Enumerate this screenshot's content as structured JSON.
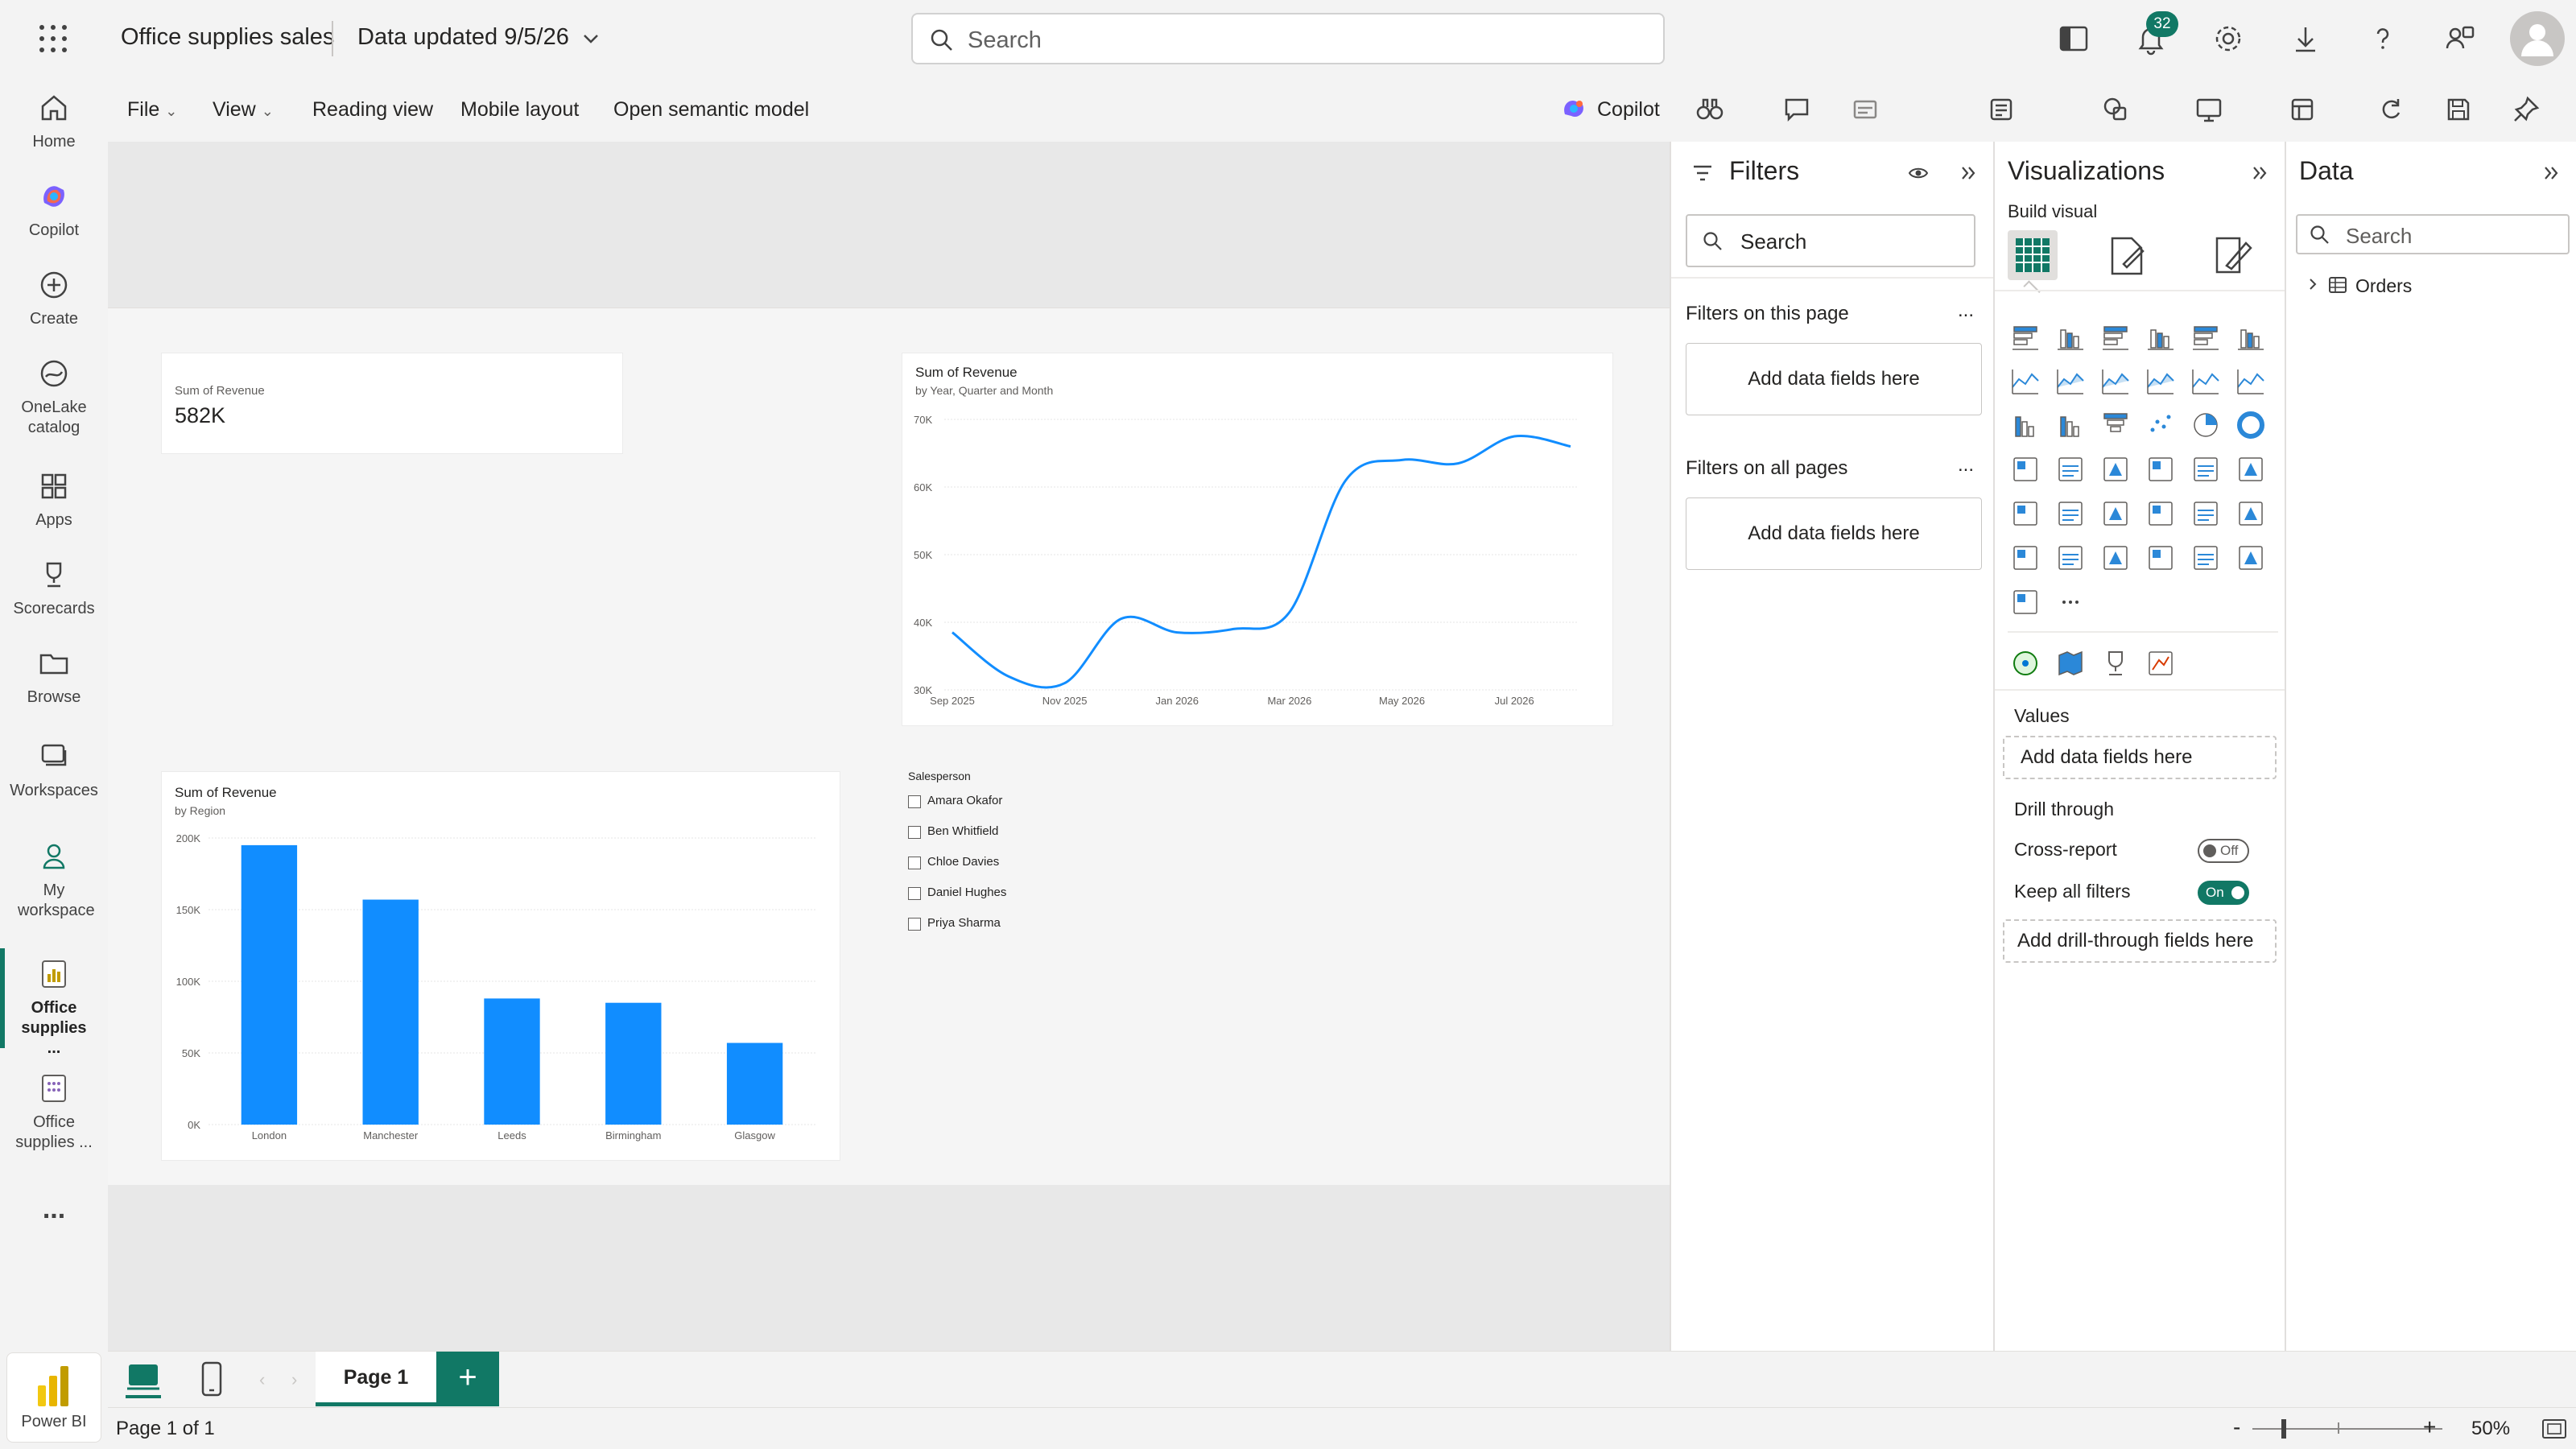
{
  "topbar": {
    "app_title": "Office supplies sales",
    "data_updated": "Data updated 9/5/26",
    "search_placeholder": "Search",
    "notification_count": "32"
  },
  "leftnav": {
    "items": [
      {
        "label": "Home",
        "icon": "home-icon"
      },
      {
        "label": "Copilot",
        "icon": "copilot-icon"
      },
      {
        "label": "Create",
        "icon": "create-icon"
      },
      {
        "label": "OneLake catalog",
        "icon": "onelake-icon"
      },
      {
        "label": "Apps",
        "icon": "apps-icon"
      },
      {
        "label": "Scorecards",
        "icon": "scorecards-icon"
      },
      {
        "label": "Browse",
        "icon": "browse-icon"
      },
      {
        "label": "Workspaces",
        "icon": "workspaces-icon"
      },
      {
        "label": "My workspace",
        "icon": "my-workspace-icon"
      },
      {
        "label": "Office supplies ...",
        "icon": "report-icon"
      },
      {
        "label": "Office supplies ...",
        "icon": "semantic-model-icon"
      }
    ],
    "more": "...",
    "footer_label": "Power BI"
  },
  "ribbon": {
    "file": "File",
    "view": "View",
    "reading_view": "Reading view",
    "mobile_layout": "Mobile layout",
    "open_semantic_model": "Open semantic model",
    "copilot": "Copilot"
  },
  "card_visual": {
    "title": "Sum of Revenue",
    "value": "582K"
  },
  "line_visual": {
    "title": "Sum of Revenue",
    "subtitle": "by Year, Quarter and Month"
  },
  "bar_visual": {
    "title": "Sum of Revenue",
    "subtitle": "by Region"
  },
  "slicer": {
    "title": "Salesperson",
    "items": [
      "Amara Okafor",
      "Ben Whitfield",
      "Chloe Davies",
      "Daniel Hughes",
      "Priya Sharma"
    ]
  },
  "chart_data": [
    {
      "type": "line",
      "title": "Sum of Revenue",
      "subtitle": "by Year, Quarter and Month",
      "x_ticks": [
        "Sep 2025",
        "Nov 2025",
        "Jan 2026",
        "Mar 2026",
        "May 2026",
        "Jul 2026"
      ],
      "y_ticks": [
        "30K",
        "40K",
        "50K",
        "60K",
        "70K"
      ],
      "ylim": [
        30000,
        70000
      ],
      "x": [
        "Sep 2025",
        "Oct 2025",
        "Nov 2025",
        "Dec 2025",
        "Jan 2026",
        "Feb 2026",
        "Mar 2026",
        "Apr 2026",
        "May 2026",
        "Jun 2026",
        "Jul 2026",
        "Aug 2026"
      ],
      "values": [
        38500,
        32000,
        31000,
        40500,
        38500,
        39000,
        41500,
        61000,
        64000,
        63500,
        67500,
        66000
      ],
      "grid": true,
      "color": "#118DFF"
    },
    {
      "type": "bar",
      "title": "Sum of Revenue",
      "subtitle": "by Region",
      "categories": [
        "London",
        "Manchester",
        "Leeds",
        "Birmingham",
        "Glasgow"
      ],
      "values": [
        195000,
        157000,
        88000,
        85000,
        57000
      ],
      "y_ticks": [
        "0K",
        "50K",
        "100K",
        "150K",
        "200K"
      ],
      "ylim": [
        0,
        200000
      ],
      "grid": true,
      "color": "#118DFF"
    }
  ],
  "filters": {
    "title": "Filters",
    "search_placeholder": "Search",
    "on_this_page": "Filters on this page",
    "on_all_pages": "Filters on all pages",
    "add_fields": "Add data fields here",
    "more": "..."
  },
  "visualizations": {
    "title": "Visualizations",
    "build_visual": "Build visual",
    "values_label": "Values",
    "values_add": "Add data fields here",
    "drill_through": "Drill through",
    "cross_report": "Cross-report",
    "cross_report_state": "Off",
    "keep_all_filters": "Keep all filters",
    "keep_all_filters_state": "On",
    "add_drill": "Add drill-through fields here",
    "more": "..."
  },
  "data_pane": {
    "title": "Data",
    "search_placeholder": "Search",
    "tables": [
      "Orders"
    ]
  },
  "pages": {
    "tabs": [
      "Page 1"
    ],
    "add": "+",
    "status": "Page 1 of 1",
    "zoom": "50%",
    "zoom_minus": "-",
    "zoom_plus": "+"
  },
  "colors": {
    "accent": "#117865",
    "series": "#118DFF",
    "pbi_yellow": "#F2C811"
  }
}
